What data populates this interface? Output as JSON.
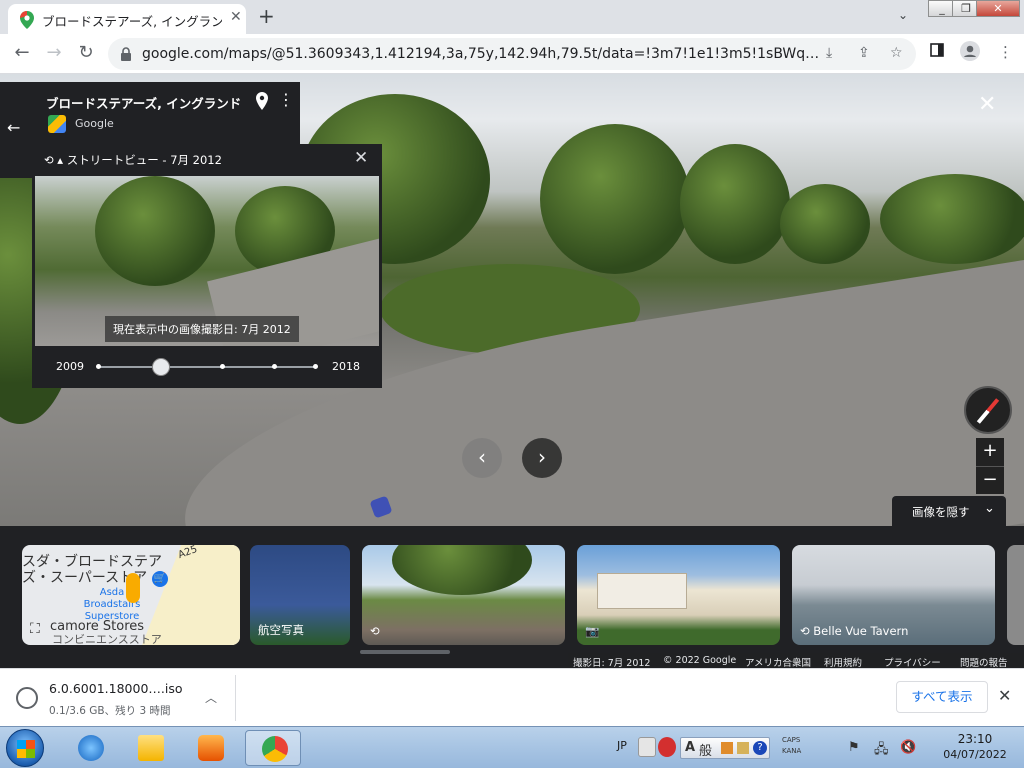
{
  "browser": {
    "tab_title": "ブロードステアーズ, イングランド",
    "tab_close": "✕",
    "new_tab": "+",
    "tab_menu": "⌄",
    "window_buttons": {
      "minimize": "_",
      "restore": "❐",
      "close": "✕"
    },
    "url": "google.com/maps/@51.3609343,1.412194,3a,75y,142.94h,79.5t/data=!3m7!1e1!3m5!1sBWq…",
    "nav": {
      "back": "←",
      "forward": "→",
      "reload": "↻"
    },
    "toolbar_icons": [
      "download-icon",
      "share-icon",
      "star-icon",
      "side-panel-icon",
      "profile-icon",
      "menu-icon"
    ]
  },
  "streetview": {
    "place_title": "ブロードステアーズ, イングランド",
    "provider": "Google",
    "back_arrow": "←",
    "close": "✕",
    "time_panel": {
      "header": "ストリートビュー - 7月 2012",
      "close": "✕",
      "tooltip": "現在表示中の画像撮影日: 7月 2012",
      "year_start": "2009",
      "year_end": "2018",
      "selected_fraction": 0.28
    },
    "zoom_in": "+",
    "zoom_out": "−",
    "prev": "‹",
    "next": "›",
    "hide_images": "画像を隠す",
    "hide_chevron": "⌄"
  },
  "filmstrip": {
    "map_card": {
      "line1": "スダ・ブロードステア",
      "line2": "ズ・スーパーストア",
      "store_en": "Asda Broadstairs Superstore",
      "store_small": "Sycamore Stores",
      "store_small_visible": "camore Stores",
      "convenience": "コンビニエンスストア",
      "road": "A25"
    },
    "cards": [
      {
        "label": "航空写真"
      },
      {
        "label": ""
      },
      {
        "label": ""
      },
      {
        "label": "Belle Vue Tavern"
      },
      {
        "label": ""
      }
    ]
  },
  "attribution": {
    "date": "撮影日: 7月 2012",
    "copyright": "© 2022 Google",
    "country": "アメリカ合衆国",
    "terms": "利用規約",
    "privacy": "プライバシー",
    "report": "問題の報告"
  },
  "download": {
    "filename": "6.0.6001.18000….iso",
    "status": "0.1/3.6 GB、残り 3 時間",
    "show_all": "すべて表示",
    "close": "✕"
  },
  "taskbar": {
    "lang": "JP",
    "ime_a": "A",
    "ime_kana": "般",
    "caps": "CAPS",
    "kana": "KANA",
    "time": "23:10",
    "date": "04/07/2022"
  },
  "colors": {
    "accent": "#1a73e8",
    "panel": "#202124"
  }
}
